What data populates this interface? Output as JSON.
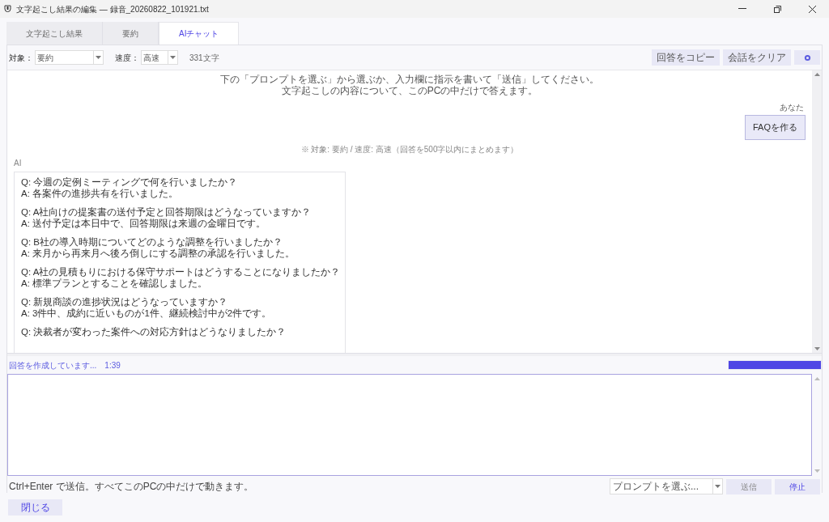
{
  "window": {
    "title": "文字起こし結果の編集 — 録音_20260822_101921.txt"
  },
  "tabs": [
    {
      "label": "文字起こし結果",
      "selected": false
    },
    {
      "label": "要約",
      "selected": false
    },
    {
      "label": "AIチャット",
      "selected": true
    }
  ],
  "toolbar": {
    "target_label": "対象：",
    "target_value": "要約",
    "speed_label": "速度：",
    "speed_value": "高速",
    "char_count": "331文字",
    "buttons": [
      "回答をコピー",
      "会話をクリア"
    ]
  },
  "chat": {
    "intro": [
      "下の「プロンプトを選ぶ」から選ぶか、入力欄に指示を書いて「送信」してください。",
      "文字起こしの内容について、このPCの中だけで答えます。"
    ],
    "user_label": "あなた",
    "user_message": "FAQを作る",
    "note": "※ 対象: 要約 / 速度: 高速（回答を500字以内にまとめます）",
    "ai_label": "AI",
    "faq": [
      {
        "lines": [
          "Q: 今週の定例ミーティングで何を行いましたか？",
          "A: 各案件の進捗共有を行いました。"
        ]
      },
      {
        "lines": [
          "Q: A社向けの提案書の送付予定と回答期限はどうなっていますか？",
          "A: 送付予定は本日中で、回答期限は来週の金曜日です。"
        ]
      },
      {
        "lines": [
          "Q: B社の導入時期についてどのような調整を行いましたか？",
          "A: 来月から再来月へ後ろ倒しにする調整の承認を行いました。"
        ]
      },
      {
        "lines": [
          "Q: A社の見積もりにおける保守サポートはどうすることになりましたか？",
          "A: 標準プランとすることを確認しました。"
        ]
      },
      {
        "lines": [
          "Q: 新規商談の進捗状況はどうなっていますか？",
          "A: 3件中、成約に近いものが1件、継続検討中が2件です。"
        ]
      },
      {
        "lines": [
          "Q: 決裁者が変わった案件への対応方針はどうなりましたか？"
        ]
      }
    ]
  },
  "status": {
    "text": "回答を作成しています...",
    "time": "1:39",
    "level": 1
  },
  "input": {
    "hint": "Ctrl+Enter で送信。すべてこのPCの中だけで動きます。",
    "prompt_placeholder": "プロンプトを選ぶ...",
    "send": "送信",
    "stop": "停止"
  },
  "close_button": "閉じる"
}
